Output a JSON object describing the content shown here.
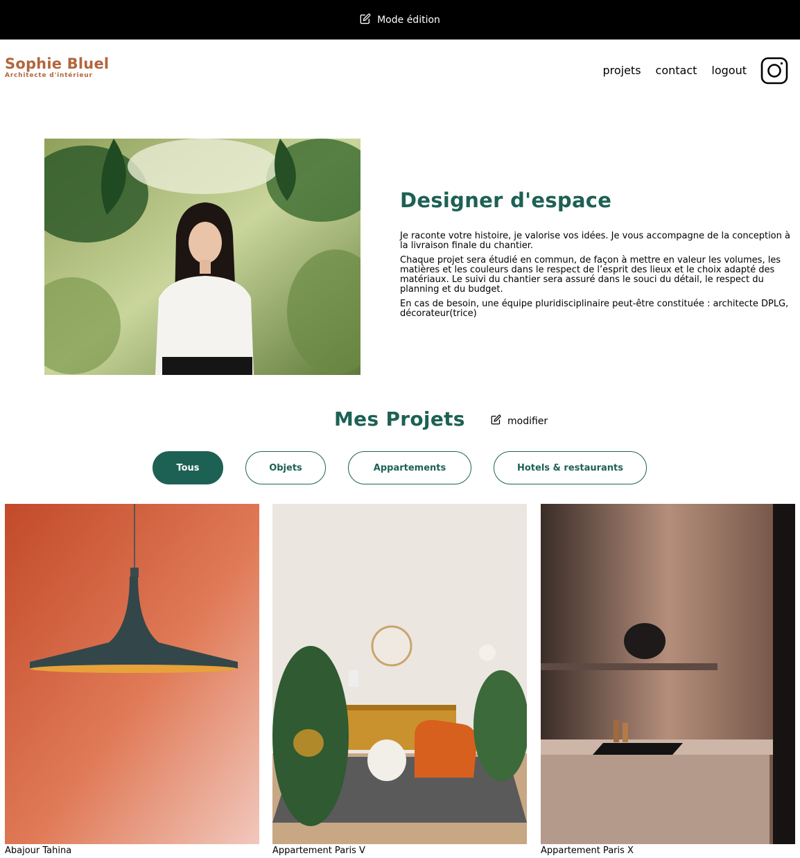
{
  "edit_bar": {
    "label": "Mode édition",
    "icon": "edit-icon"
  },
  "header": {
    "logo_title": "Sophie Bluel",
    "logo_subtitle": "Architecte d'intérieur",
    "nav": [
      "projets",
      "contact",
      "logout"
    ],
    "social_icon": "instagram-icon"
  },
  "intro": {
    "title": "Designer d'espace",
    "paragraphs": [
      "Je raconte votre histoire, je valorise vos idées. Je vous accompagne de la conception à la livraison finale du chantier.",
      "Chaque projet sera étudié en commun, de façon à mettre en valeur les volumes, les matières et les couleurs dans le respect de l’esprit des lieux et le choix adapté des matériaux. Le suivi du chantier sera assuré dans le souci du détail, le respect du planning et du budget.",
      "En cas de besoin, une équipe pluridisciplinaire peut-être constituée : architecte DPLG, décorateur(trice)"
    ]
  },
  "projects": {
    "title": "Mes Projets",
    "modify_label": "modifier",
    "filters": [
      "Tous",
      "Objets",
      "Appartements",
      "Hotels & restaurants"
    ],
    "active_filter": "Tous",
    "items": [
      {
        "caption": "Abajour Tahina"
      },
      {
        "caption": "Appartement Paris V"
      },
      {
        "caption": "Appartement Paris X"
      }
    ]
  },
  "colors": {
    "accent": "#1D6154",
    "brand": "#B1663C",
    "edit_bar": "#000000"
  }
}
